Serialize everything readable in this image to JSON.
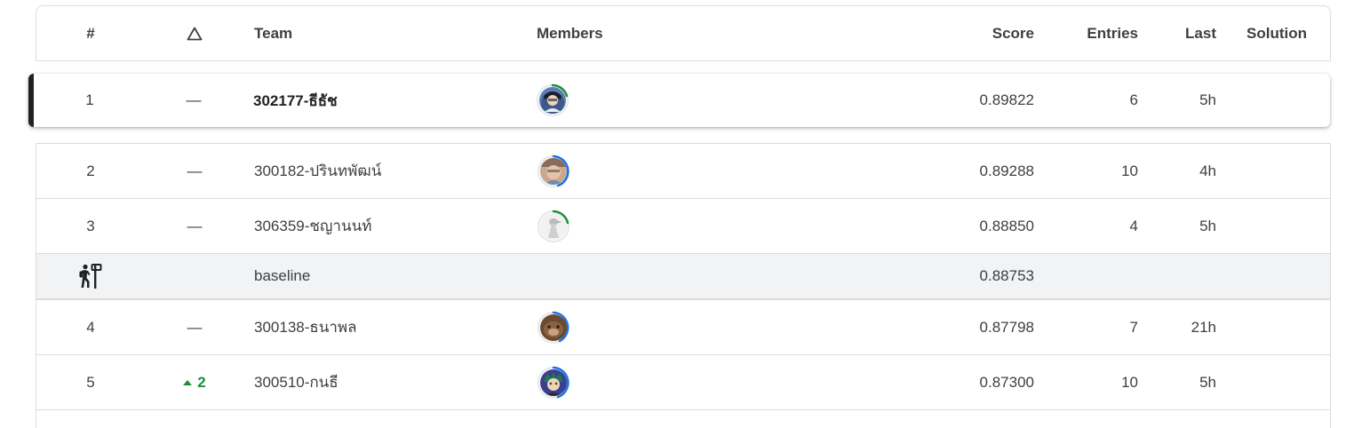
{
  "columns": {
    "rank": "#",
    "delta_icon": "triangle-outline-icon",
    "team": "Team",
    "members": "Members",
    "score": "Score",
    "entries": "Entries",
    "last": "Last",
    "solution": "Solution"
  },
  "rows": [
    {
      "rank": "1",
      "delta": "—",
      "team": "302177-ธีธัช",
      "score": "0.89822",
      "entries": "6",
      "last": "5h",
      "avatar": "avatar-anime-dark",
      "ring_color": "#1e8e3e",
      "highlighted": true
    },
    {
      "rank": "2",
      "delta": "—",
      "team": "300182-ปรินทพัฒน์",
      "score": "0.89288",
      "entries": "10",
      "last": "4h",
      "avatar": "avatar-photo-person",
      "ring_color": "#1a73e8"
    },
    {
      "rank": "3",
      "delta": "—",
      "team": "306359-ชญานนท์",
      "score": "0.88850",
      "entries": "4",
      "last": "5h",
      "avatar": "avatar-bird-sketch",
      "ring_color": "#1e8e3e"
    }
  ],
  "baseline": {
    "icon": "hiker-signpost-icon",
    "team": "baseline",
    "score": "0.88753"
  },
  "rows_after": [
    {
      "rank": "4",
      "delta": "—",
      "team": "300138-ธนาพล",
      "score": "0.87798",
      "entries": "7",
      "last": "21h",
      "avatar": "avatar-brown-animal",
      "ring_color": "#1a73e8"
    },
    {
      "rank": "5",
      "delta": "2",
      "delta_direction": "up",
      "team": "300510-กนธี",
      "score": "0.87300",
      "entries": "10",
      "last": "5h",
      "avatar": "avatar-anime-green-hair",
      "ring_color": "#1a73e8"
    }
  ],
  "colors": {
    "positive": "#1e8e3e",
    "ring_blue": "#1a73e8",
    "ring_green": "#1e8e3e",
    "baseline_bg": "#f1f3f4"
  }
}
